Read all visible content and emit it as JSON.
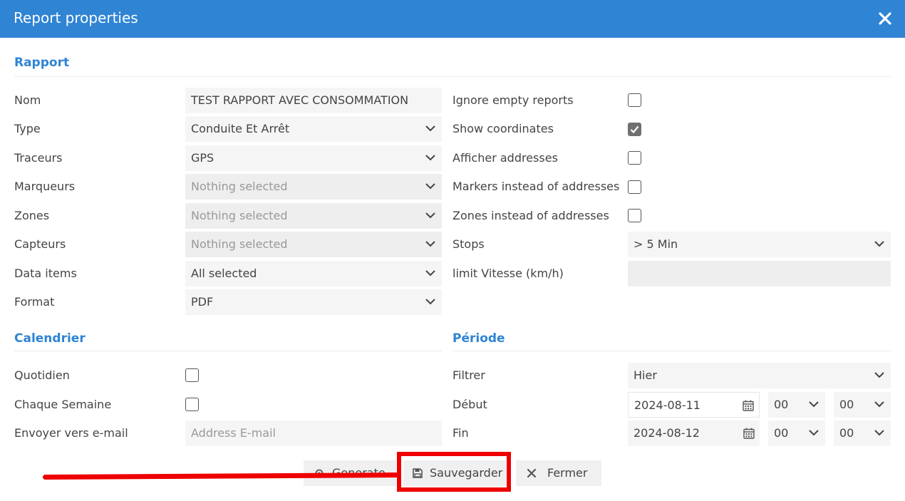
{
  "window": {
    "title": "Report properties"
  },
  "sections": {
    "rapport": "Rapport",
    "calendrier": "Calendrier",
    "periode": "Période"
  },
  "left_form": {
    "nom": {
      "label": "Nom",
      "value": "TEST RAPPORT AVEC CONSOMMATION"
    },
    "type": {
      "label": "Type",
      "value": "Conduite Et Arrêt"
    },
    "traceurs": {
      "label": "Traceurs",
      "value": "GPS"
    },
    "marqueurs": {
      "label": "Marqueurs",
      "value": "Nothing selected"
    },
    "zones": {
      "label": "Zones",
      "value": "Nothing selected"
    },
    "capteurs": {
      "label": "Capteurs",
      "value": "Nothing selected"
    },
    "data_items": {
      "label": "Data items",
      "value": "All selected"
    },
    "format": {
      "label": "Format",
      "value": "PDF"
    }
  },
  "right_form": {
    "ignore_empty": {
      "label": "Ignore empty reports",
      "checked": false
    },
    "show_coords": {
      "label": "Show coordinates",
      "checked": true
    },
    "afficher_addr": {
      "label": "Afficher addresses",
      "checked": false
    },
    "markers_instead": {
      "label": "Markers instead of addresses",
      "checked": false
    },
    "zones_instead": {
      "label": "Zones instead of addresses",
      "checked": false
    },
    "stops": {
      "label": "Stops",
      "value": "> 5 Min"
    },
    "limit_vitesse": {
      "label": "limit Vitesse (km/h)",
      "value": ""
    }
  },
  "calendrier": {
    "quotidien": {
      "label": "Quotidien",
      "checked": false
    },
    "chaque_semaine": {
      "label": "Chaque Semaine",
      "checked": false
    },
    "envoyer": {
      "label": "Envoyer vers e-mail",
      "placeholder": "Address E-mail"
    }
  },
  "periode": {
    "filtrer": {
      "label": "Filtrer",
      "value": "Hier"
    },
    "debut": {
      "label": "Début",
      "date": "2024-08-11",
      "hour": "00",
      "minute": "00"
    },
    "fin": {
      "label": "Fin",
      "date": "2024-08-12",
      "hour": "00",
      "minute": "00"
    }
  },
  "buttons": {
    "generate": "Generate",
    "sauvegarder": "Sauvegarder",
    "fermer": "Fermer"
  },
  "colors": {
    "header_bg": "#2f84d4",
    "section_text": "#2f84d4",
    "annotation_red": "#ee0000"
  }
}
